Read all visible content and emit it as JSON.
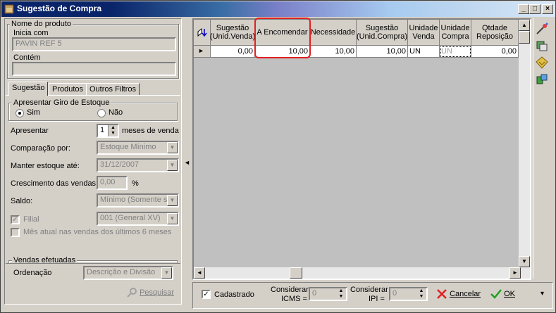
{
  "window": {
    "title": "Sugestão de Compra",
    "controls": {
      "minimize": "_",
      "maximize": "□",
      "close": "×"
    }
  },
  "left": {
    "product_group": {
      "legend": "Nome do produto",
      "starts_with_label": "Inicia com",
      "starts_with_value": "PAVIN REF 5",
      "contains_label": "Contém",
      "contains_value": ""
    },
    "tabs": [
      "Sugestão",
      "Produtos",
      "Outros Filtros"
    ],
    "stock_group": {
      "legend": "Apresentar Giro de Estoque",
      "yes_label": "Sim",
      "no_label": "Não"
    },
    "present_label": "Apresentar",
    "present_value": "1",
    "present_suffix": "meses de venda",
    "comparison_label": "Comparação por:",
    "comparison_value": "Estoque Mínimo",
    "keep_stock_label": "Manter estoque até:",
    "keep_stock_value": "31/12/2007",
    "growth_label": "Crescimento das vendas:",
    "growth_value": "0,00",
    "growth_unit": "%",
    "balance_label": "Saldo:",
    "balance_value": "Mínimo (Somente se",
    "branch_label": "Filial",
    "branch_value": "001 (General XV)",
    "current_month_label": "Mês atual nas vendas dos últimos 6 meses",
    "sales_legend": "Vendas efetuadas",
    "order_label": "Ordenação",
    "order_value": "Descrição e Divisão",
    "search_label": "Pesquisar",
    "collapse_arrow": "◄"
  },
  "grid": {
    "columns": [
      "Sugestão (Unid.Venda)",
      "A Encomendar",
      "Necessidade",
      "Sugestão (Unid.Compra)",
      "Unidade Venda",
      "Unidade Compra",
      "Qtdade Reposição"
    ],
    "rows": [
      [
        "0,00",
        "10,00",
        "10,00",
        "10,00",
        "UN",
        "UN",
        "0,00"
      ]
    ],
    "row_indicator": "►"
  },
  "footer": {
    "registered_label": "Cadastrado",
    "icms_label_1": "Considerar",
    "icms_label_2": "ICMS =",
    "icms_value": "0",
    "ipi_label_1": "Considerar",
    "ipi_label_2": "IPI =",
    "ipi_value": "0",
    "cancel_label": "Cancelar",
    "ok_label": "OK",
    "menu_arrow": "▾"
  },
  "icons": {
    "highlight_color": "#e02020",
    "title_bg": "#0a246a"
  }
}
